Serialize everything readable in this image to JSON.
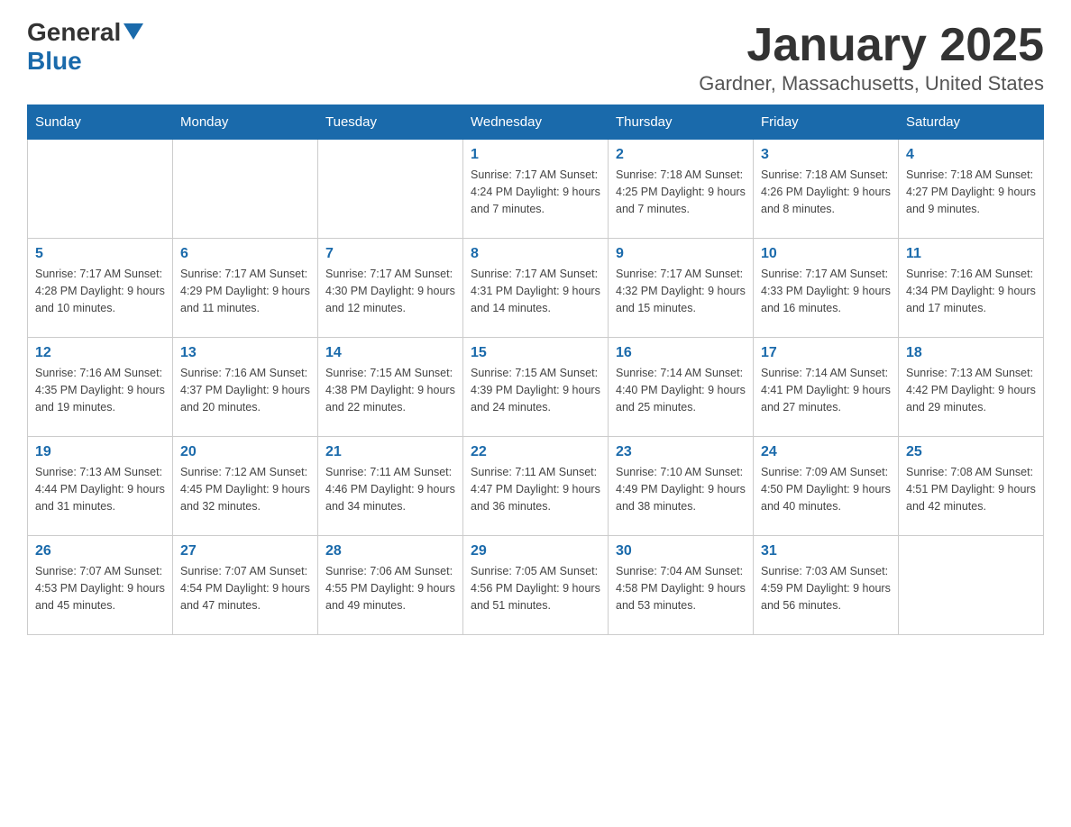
{
  "header": {
    "logo_general": "General",
    "logo_blue": "Blue",
    "month_title": "January 2025",
    "location": "Gardner, Massachusetts, United States"
  },
  "days_of_week": [
    "Sunday",
    "Monday",
    "Tuesday",
    "Wednesday",
    "Thursday",
    "Friday",
    "Saturday"
  ],
  "weeks": [
    [
      {
        "day": "",
        "info": ""
      },
      {
        "day": "",
        "info": ""
      },
      {
        "day": "",
        "info": ""
      },
      {
        "day": "1",
        "info": "Sunrise: 7:17 AM\nSunset: 4:24 PM\nDaylight: 9 hours and 7 minutes."
      },
      {
        "day": "2",
        "info": "Sunrise: 7:18 AM\nSunset: 4:25 PM\nDaylight: 9 hours and 7 minutes."
      },
      {
        "day": "3",
        "info": "Sunrise: 7:18 AM\nSunset: 4:26 PM\nDaylight: 9 hours and 8 minutes."
      },
      {
        "day": "4",
        "info": "Sunrise: 7:18 AM\nSunset: 4:27 PM\nDaylight: 9 hours and 9 minutes."
      }
    ],
    [
      {
        "day": "5",
        "info": "Sunrise: 7:17 AM\nSunset: 4:28 PM\nDaylight: 9 hours and 10 minutes."
      },
      {
        "day": "6",
        "info": "Sunrise: 7:17 AM\nSunset: 4:29 PM\nDaylight: 9 hours and 11 minutes."
      },
      {
        "day": "7",
        "info": "Sunrise: 7:17 AM\nSunset: 4:30 PM\nDaylight: 9 hours and 12 minutes."
      },
      {
        "day": "8",
        "info": "Sunrise: 7:17 AM\nSunset: 4:31 PM\nDaylight: 9 hours and 14 minutes."
      },
      {
        "day": "9",
        "info": "Sunrise: 7:17 AM\nSunset: 4:32 PM\nDaylight: 9 hours and 15 minutes."
      },
      {
        "day": "10",
        "info": "Sunrise: 7:17 AM\nSunset: 4:33 PM\nDaylight: 9 hours and 16 minutes."
      },
      {
        "day": "11",
        "info": "Sunrise: 7:16 AM\nSunset: 4:34 PM\nDaylight: 9 hours and 17 minutes."
      }
    ],
    [
      {
        "day": "12",
        "info": "Sunrise: 7:16 AM\nSunset: 4:35 PM\nDaylight: 9 hours and 19 minutes."
      },
      {
        "day": "13",
        "info": "Sunrise: 7:16 AM\nSunset: 4:37 PM\nDaylight: 9 hours and 20 minutes."
      },
      {
        "day": "14",
        "info": "Sunrise: 7:15 AM\nSunset: 4:38 PM\nDaylight: 9 hours and 22 minutes."
      },
      {
        "day": "15",
        "info": "Sunrise: 7:15 AM\nSunset: 4:39 PM\nDaylight: 9 hours and 24 minutes."
      },
      {
        "day": "16",
        "info": "Sunrise: 7:14 AM\nSunset: 4:40 PM\nDaylight: 9 hours and 25 minutes."
      },
      {
        "day": "17",
        "info": "Sunrise: 7:14 AM\nSunset: 4:41 PM\nDaylight: 9 hours and 27 minutes."
      },
      {
        "day": "18",
        "info": "Sunrise: 7:13 AM\nSunset: 4:42 PM\nDaylight: 9 hours and 29 minutes."
      }
    ],
    [
      {
        "day": "19",
        "info": "Sunrise: 7:13 AM\nSunset: 4:44 PM\nDaylight: 9 hours and 31 minutes."
      },
      {
        "day": "20",
        "info": "Sunrise: 7:12 AM\nSunset: 4:45 PM\nDaylight: 9 hours and 32 minutes."
      },
      {
        "day": "21",
        "info": "Sunrise: 7:11 AM\nSunset: 4:46 PM\nDaylight: 9 hours and 34 minutes."
      },
      {
        "day": "22",
        "info": "Sunrise: 7:11 AM\nSunset: 4:47 PM\nDaylight: 9 hours and 36 minutes."
      },
      {
        "day": "23",
        "info": "Sunrise: 7:10 AM\nSunset: 4:49 PM\nDaylight: 9 hours and 38 minutes."
      },
      {
        "day": "24",
        "info": "Sunrise: 7:09 AM\nSunset: 4:50 PM\nDaylight: 9 hours and 40 minutes."
      },
      {
        "day": "25",
        "info": "Sunrise: 7:08 AM\nSunset: 4:51 PM\nDaylight: 9 hours and 42 minutes."
      }
    ],
    [
      {
        "day": "26",
        "info": "Sunrise: 7:07 AM\nSunset: 4:53 PM\nDaylight: 9 hours and 45 minutes."
      },
      {
        "day": "27",
        "info": "Sunrise: 7:07 AM\nSunset: 4:54 PM\nDaylight: 9 hours and 47 minutes."
      },
      {
        "day": "28",
        "info": "Sunrise: 7:06 AM\nSunset: 4:55 PM\nDaylight: 9 hours and 49 minutes."
      },
      {
        "day": "29",
        "info": "Sunrise: 7:05 AM\nSunset: 4:56 PM\nDaylight: 9 hours and 51 minutes."
      },
      {
        "day": "30",
        "info": "Sunrise: 7:04 AM\nSunset: 4:58 PM\nDaylight: 9 hours and 53 minutes."
      },
      {
        "day": "31",
        "info": "Sunrise: 7:03 AM\nSunset: 4:59 PM\nDaylight: 9 hours and 56 minutes."
      },
      {
        "day": "",
        "info": ""
      }
    ]
  ]
}
